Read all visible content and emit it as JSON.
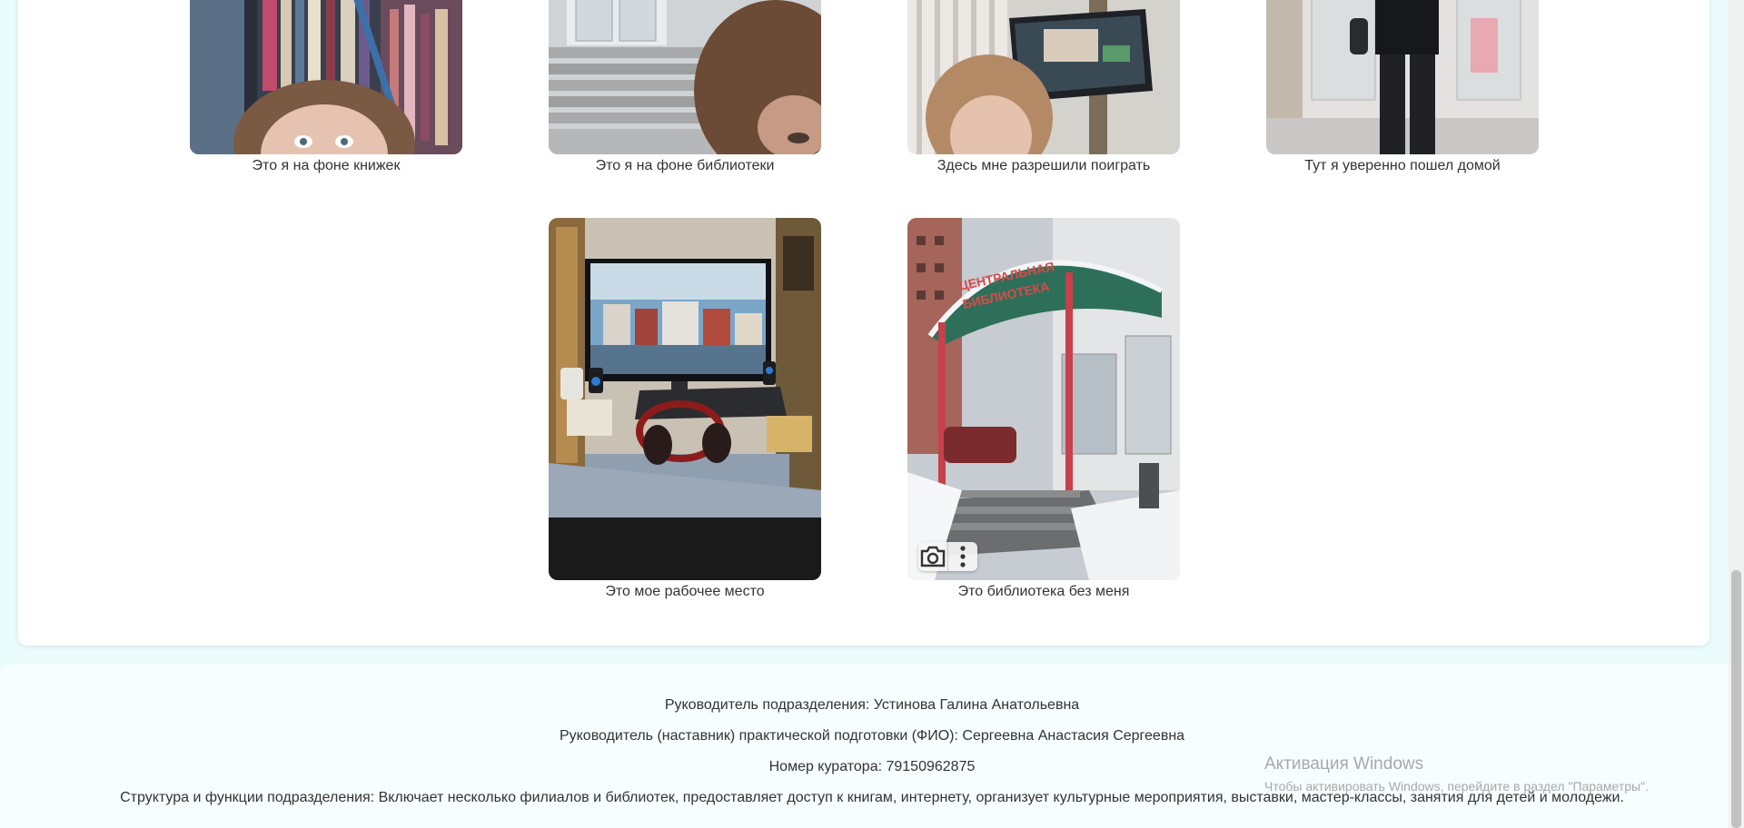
{
  "gallery": {
    "captions": [
      "Это я на фоне книжек",
      "Это я на фоне библиотеки",
      "Здесь мне разрешили поиграть",
      "Тут я уверенно пошел домой",
      "Это мое рабочее место",
      "Это библиотека без меня"
    ],
    "photo_sign": [
      "ЦЕНТРАЛЬНАЯ",
      "БИБЛИОТЕКА"
    ]
  },
  "image_overlay": {
    "icons": [
      "camera-icon",
      "more-vertical-icon"
    ]
  },
  "footer": {
    "head": "Руководитель подразделения: Устинова Галина Анатольевна",
    "mentor": "Руководитель (наставник) практической подготовки (ФИО): Сергеевна Анастасия Сергеевна",
    "curator_phone": "Номер куратора: 79150962875",
    "structure": "Структура и функции подразделения: Включает несколько филиалов и библиотек, предоставляет доступ к книгам, интернету, организует культурные мероприятия, выставки, мастер-классы, занятия для детей и молодежи."
  },
  "windows_activation": {
    "title": "Активация Windows",
    "subtitle": "Чтобы активировать Windows, перейдите в раздел \"Параметры\"."
  },
  "colors": {
    "page_bg": "#eafcfc",
    "card_bg": "#ffffff",
    "footer_bg": "#f6fefe",
    "text": "#333333",
    "watermark": "#a8a8a8"
  }
}
